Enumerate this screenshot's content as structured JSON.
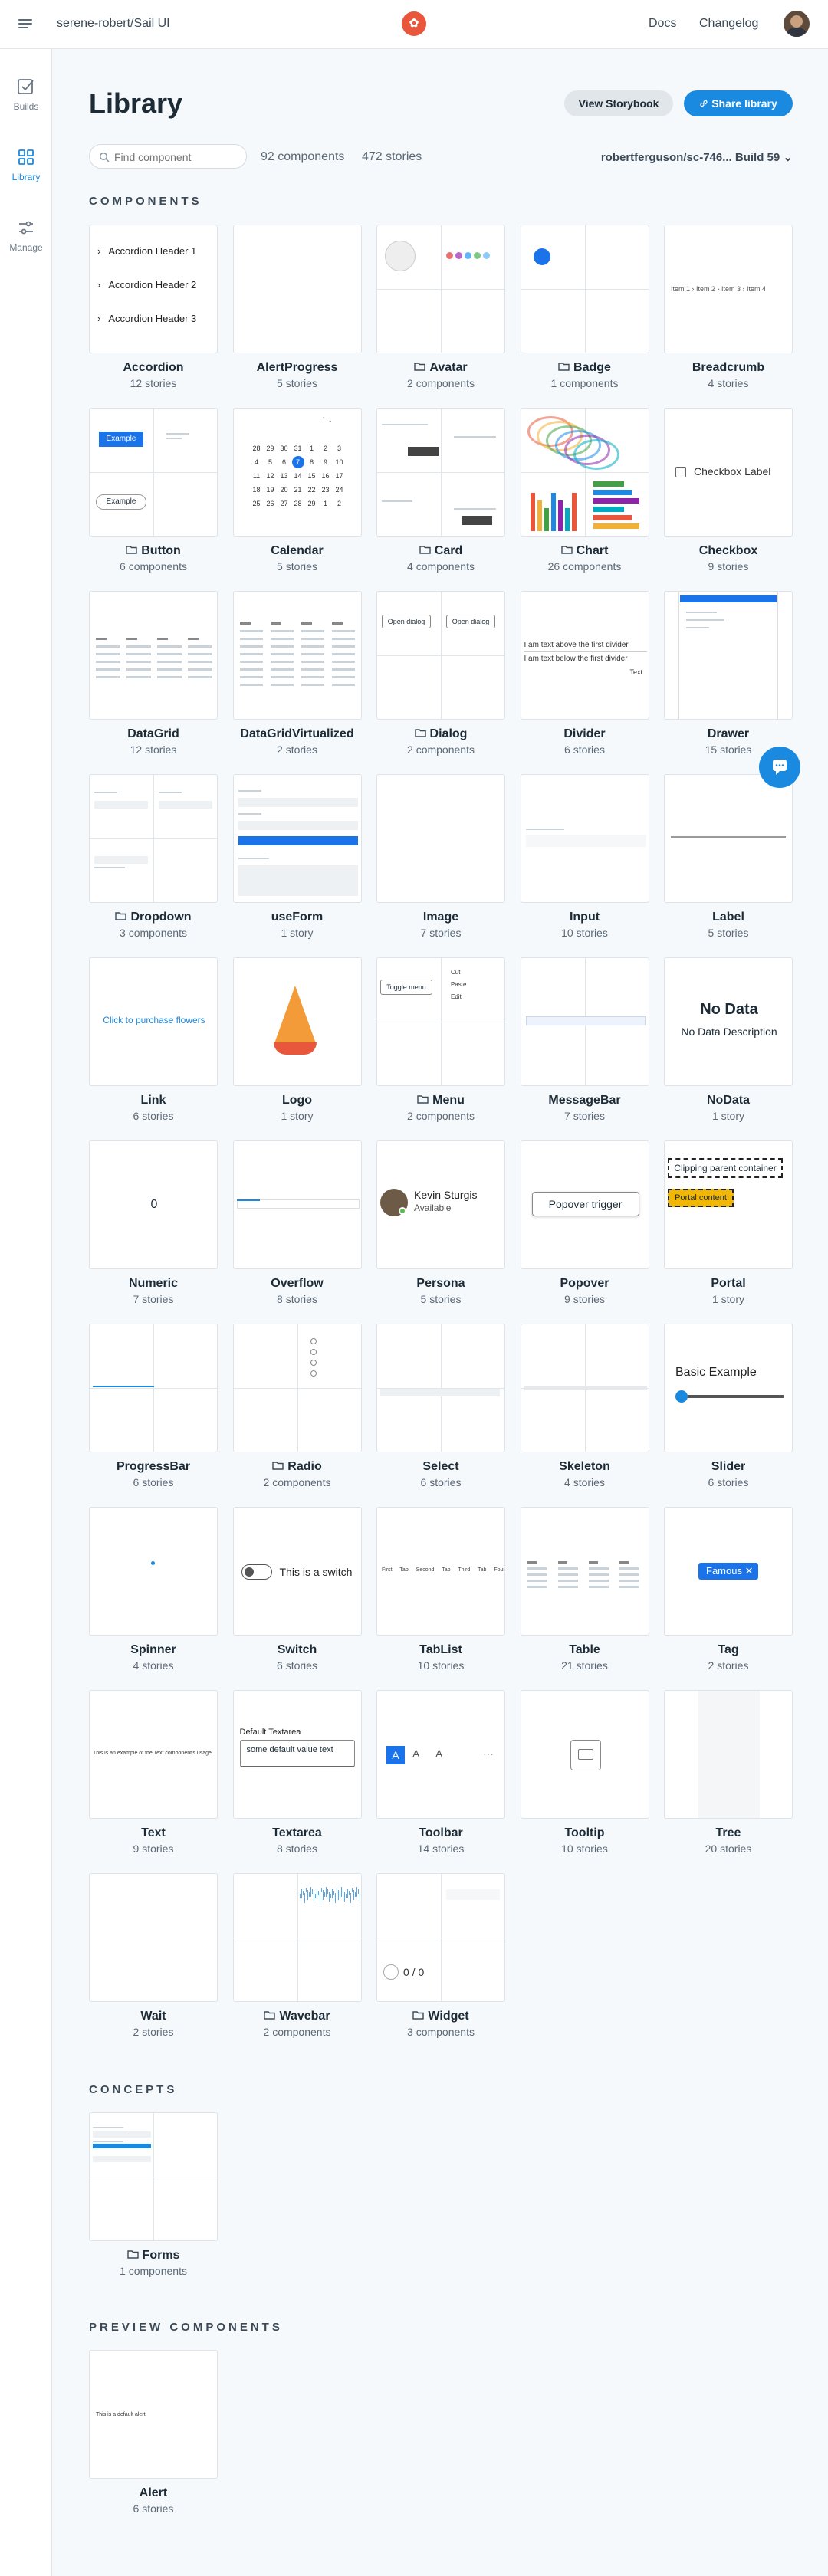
{
  "header": {
    "repo": "serene-robert/Sail UI",
    "logo_glyph": "✿",
    "docs": "Docs",
    "changelog": "Changelog"
  },
  "sidebar": [
    {
      "label": "Builds"
    },
    {
      "label": "Library"
    },
    {
      "label": "Manage"
    }
  ],
  "page": {
    "title": "Library",
    "view_storybook": "View Storybook",
    "share_library": "Share library",
    "search_placeholder": "Find component",
    "component_count": "92 components",
    "story_count": "472 stories",
    "branch_build": "robertferguson/sc-746... Build 59"
  },
  "sections": {
    "components": "COMPONENTS",
    "concepts": "CONCEPTS",
    "preview": "PREVIEW COMPONENTS"
  },
  "components": [
    {
      "name": "Accordion",
      "sub": "12 stories",
      "folder": false
    },
    {
      "name": "AlertProgress",
      "sub": "5 stories",
      "folder": false
    },
    {
      "name": "Avatar",
      "sub": "2 components",
      "folder": true
    },
    {
      "name": "Badge",
      "sub": "1 components",
      "folder": true
    },
    {
      "name": "Breadcrumb",
      "sub": "4 stories",
      "folder": false
    },
    {
      "name": "Button",
      "sub": "6 components",
      "folder": true
    },
    {
      "name": "Calendar",
      "sub": "5 stories",
      "folder": false
    },
    {
      "name": "Card",
      "sub": "4 components",
      "folder": true
    },
    {
      "name": "Chart",
      "sub": "26 components",
      "folder": true
    },
    {
      "name": "Checkbox",
      "sub": "9 stories",
      "folder": false
    },
    {
      "name": "DataGrid",
      "sub": "12 stories",
      "folder": false
    },
    {
      "name": "DataGridVirtualized",
      "sub": "2 stories",
      "folder": false
    },
    {
      "name": "Dialog",
      "sub": "2 components",
      "folder": true
    },
    {
      "name": "Divider",
      "sub": "6 stories",
      "folder": false
    },
    {
      "name": "Drawer",
      "sub": "15 stories",
      "folder": false
    },
    {
      "name": "Dropdown",
      "sub": "3 components",
      "folder": true
    },
    {
      "name": "useForm",
      "sub": "1 story",
      "folder": false
    },
    {
      "name": "Image",
      "sub": "7 stories",
      "folder": false
    },
    {
      "name": "Input",
      "sub": "10 stories",
      "folder": false
    },
    {
      "name": "Label",
      "sub": "5 stories",
      "folder": false
    },
    {
      "name": "Link",
      "sub": "6 stories",
      "folder": false
    },
    {
      "name": "Logo",
      "sub": "1 story",
      "folder": false
    },
    {
      "name": "Menu",
      "sub": "2 components",
      "folder": true
    },
    {
      "name": "MessageBar",
      "sub": "7 stories",
      "folder": false
    },
    {
      "name": "NoData",
      "sub": "1 story",
      "folder": false
    },
    {
      "name": "Numeric",
      "sub": "7 stories",
      "folder": false
    },
    {
      "name": "Overflow",
      "sub": "8 stories",
      "folder": false
    },
    {
      "name": "Persona",
      "sub": "5 stories",
      "folder": false
    },
    {
      "name": "Popover",
      "sub": "9 stories",
      "folder": false
    },
    {
      "name": "Portal",
      "sub": "1 story",
      "folder": false
    },
    {
      "name": "ProgressBar",
      "sub": "6 stories",
      "folder": false
    },
    {
      "name": "Radio",
      "sub": "2 components",
      "folder": true
    },
    {
      "name": "Select",
      "sub": "6 stories",
      "folder": false
    },
    {
      "name": "Skeleton",
      "sub": "4 stories",
      "folder": false
    },
    {
      "name": "Slider",
      "sub": "6 stories",
      "folder": false
    },
    {
      "name": "Spinner",
      "sub": "4 stories",
      "folder": false
    },
    {
      "name": "Switch",
      "sub": "6 stories",
      "folder": false
    },
    {
      "name": "TabList",
      "sub": "10 stories",
      "folder": false
    },
    {
      "name": "Table",
      "sub": "21 stories",
      "folder": false
    },
    {
      "name": "Tag",
      "sub": "2 stories",
      "folder": false
    },
    {
      "name": "Text",
      "sub": "9 stories",
      "folder": false
    },
    {
      "name": "Textarea",
      "sub": "8 stories",
      "folder": false
    },
    {
      "name": "Toolbar",
      "sub": "14 stories",
      "folder": false
    },
    {
      "name": "Tooltip",
      "sub": "10 stories",
      "folder": false
    },
    {
      "name": "Tree",
      "sub": "20 stories",
      "folder": false
    },
    {
      "name": "Wait",
      "sub": "2 stories",
      "folder": false
    },
    {
      "name": "Wavebar",
      "sub": "2 components",
      "folder": true
    },
    {
      "name": "Widget",
      "sub": "3 components",
      "folder": true
    }
  ],
  "concepts": [
    {
      "name": "Forms",
      "sub": "1 components",
      "folder": true
    }
  ],
  "preview": [
    {
      "name": "Alert",
      "sub": "6 stories",
      "folder": false
    }
  ],
  "thumb_text": {
    "accordion": [
      "Accordion Header 1",
      "Accordion Header 2",
      "Accordion Header 3"
    ],
    "breadcrumb": [
      "Item 1",
      "Item 2",
      "Item 3",
      "Item 4"
    ],
    "button": [
      "Example",
      "Example"
    ],
    "calendar": [
      "28",
      "29",
      "30",
      "31",
      "1",
      "2",
      "3",
      "4",
      "5",
      "6",
      "7",
      "8",
      "9",
      "10",
      "11",
      "12",
      "13",
      "14",
      "15",
      "16",
      "17",
      "18",
      "19",
      "20",
      "21",
      "22",
      "23",
      "24",
      "25",
      "26",
      "27",
      "28",
      "29",
      "1",
      "2"
    ],
    "checkbox": "Checkbox Label",
    "dialog": [
      "Open dialog",
      "Open dialog"
    ],
    "divider": [
      "I am text above the first divider",
      "I am text below the first divider",
      "Text"
    ],
    "link": "Click to purchase flowers",
    "menu": [
      "Toggle menu",
      "Cut",
      "Paste",
      "Edit"
    ],
    "nodata": [
      "No Data",
      "No Data Description"
    ],
    "numeric": "0",
    "persona": [
      "Kevin Sturgis",
      "Available"
    ],
    "popover": "Popover trigger",
    "portal": [
      "Clipping parent container",
      "Portal content"
    ],
    "slider": "Basic Example",
    "switch": "This is a switch",
    "tablist": [
      "First Tab",
      "Second Tab",
      "Third Tab",
      "Fourth Tab"
    ],
    "tag": "Famous",
    "text": "This is an example of the Text component's usage.",
    "textarea": [
      "Default Textarea",
      "some default value text"
    ],
    "widget": "0 / 0",
    "alert": "This is a default alert."
  },
  "colors": {
    "accent": "#1a8ae0",
    "brand": "#e8573c",
    "text": "#1c2b36",
    "muted": "#5b6976",
    "bg": "#f6f9fc"
  }
}
